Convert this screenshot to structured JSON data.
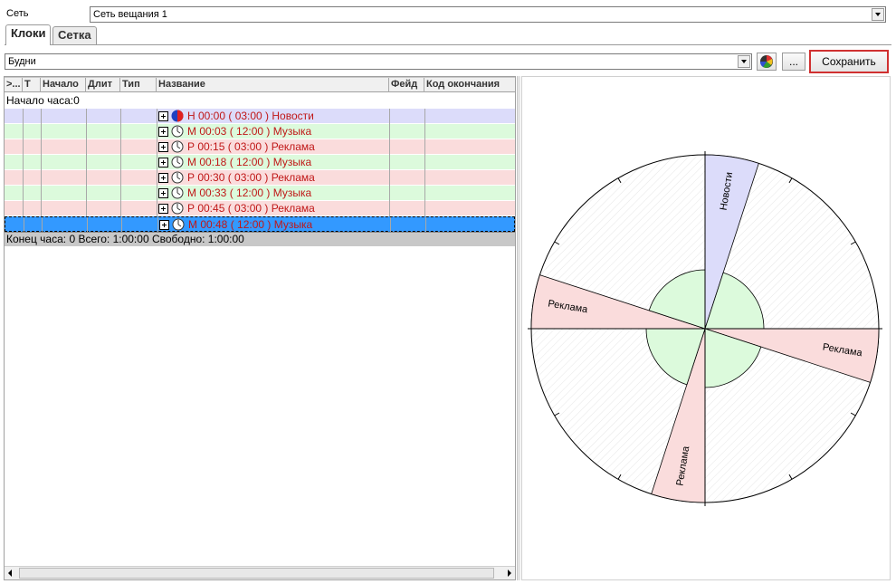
{
  "network": {
    "label": "Сеть",
    "value": "Сеть вещания 1"
  },
  "tabs": [
    {
      "label": "Клоки"
    },
    {
      "label": "Сетка"
    }
  ],
  "clock_select": {
    "value": "Будни"
  },
  "toolbar": {
    "ellipsis_label": "...",
    "save_label": "Сохранить"
  },
  "grid": {
    "columns": [
      ">...",
      "Т",
      "Начало",
      "Длит",
      "Тип",
      "Название",
      "Фейд",
      "Код окончания"
    ],
    "hour_start": "Начало часа:0",
    "rows": [
      {
        "text": "Н 00:00 ( 03:00 ) Новости",
        "type": "news",
        "selected": false
      },
      {
        "text": "М 00:03 ( 12:00 ) Музыка",
        "type": "music",
        "selected": false
      },
      {
        "text": "Р 00:15 ( 03:00 ) Реклама",
        "type": "ad",
        "selected": false
      },
      {
        "text": "М 00:18 ( 12:00 ) Музыка",
        "type": "music",
        "selected": false
      },
      {
        "text": "Р 00:30 ( 03:00 ) Реклама",
        "type": "ad",
        "selected": false
      },
      {
        "text": "М 00:33 ( 12:00 ) Музыка",
        "type": "music",
        "selected": false
      },
      {
        "text": "Р 00:45 ( 03:00 ) Реклама",
        "type": "ad",
        "selected": false
      },
      {
        "text": "М 00:48 ( 12:00 ) Музыка",
        "type": "music",
        "selected": true
      }
    ],
    "hour_end": "Конец часа: 0 Всего: 1:00:00 Свободно:  1:00:00"
  },
  "clock_chart": {
    "segments": [
      {
        "label": "Новости",
        "start_min": 0,
        "duration_min": 3,
        "kind": "news"
      },
      {
        "label": "",
        "start_min": 3,
        "duration_min": 12,
        "kind": "music"
      },
      {
        "label": "Реклама",
        "start_min": 15,
        "duration_min": 3,
        "kind": "ad"
      },
      {
        "label": "",
        "start_min": 18,
        "duration_min": 12,
        "kind": "music"
      },
      {
        "label": "Реклама",
        "start_min": 30,
        "duration_min": 3,
        "kind": "ad"
      },
      {
        "label": "",
        "start_min": 33,
        "duration_min": 12,
        "kind": "music"
      },
      {
        "label": "Реклама",
        "start_min": 45,
        "duration_min": 3,
        "kind": "ad"
      },
      {
        "label": "",
        "start_min": 48,
        "duration_min": 12,
        "kind": "music"
      }
    ]
  },
  "colors": {
    "news": "#dcdcfa",
    "music": "#dcfadc",
    "ad": "#fadcdc",
    "selected": "#3399ff",
    "save_border": "#d03030",
    "row_text": "#c01818"
  },
  "icons": [
    "expand-icon",
    "clock-icon",
    "palette-icon",
    "scroll-left-icon",
    "scroll-right-icon",
    "combo-arrow-icon"
  ]
}
